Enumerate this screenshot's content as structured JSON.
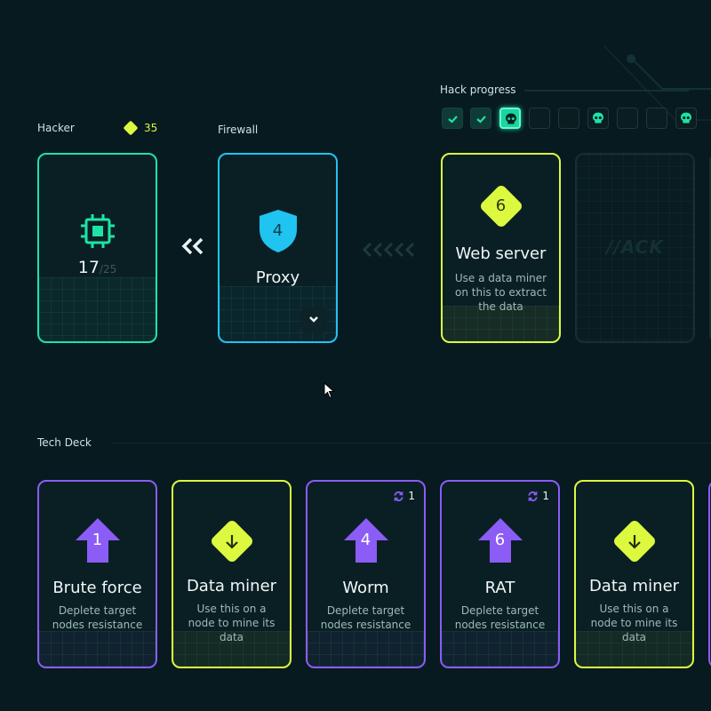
{
  "hacker": {
    "label": "Hacker",
    "currency": "35",
    "hp": "17",
    "hp_max": "/25"
  },
  "firewall": {
    "label": "Firewall",
    "value": "4",
    "name": "Proxy"
  },
  "hack_progress": {
    "label": "Hack progress",
    "steps": [
      "done",
      "done",
      "current-skull",
      "empty",
      "empty",
      "skull",
      "empty",
      "empty",
      "skull"
    ]
  },
  "target": {
    "value": "6",
    "name": "Web server",
    "desc": "Use a data miner on this to extract the data"
  },
  "locked_card_logo": "//ACK",
  "tech_deck": {
    "label": "Tech Deck",
    "cards": [
      {
        "type": "attack",
        "value": "1",
        "name": "Brute force",
        "desc": "Deplete target nodes resistance",
        "badge": ""
      },
      {
        "type": "miner",
        "value": "",
        "name": "Data miner",
        "desc": "Use this on a node to mine its data",
        "badge": ""
      },
      {
        "type": "attack",
        "value": "4",
        "name": "Worm",
        "desc": "Deplete target nodes resistance",
        "badge": "1"
      },
      {
        "type": "attack",
        "value": "6",
        "name": "RAT",
        "desc": "Deplete target nodes resistance",
        "badge": "1"
      },
      {
        "type": "miner",
        "value": "",
        "name": "Data miner",
        "desc": "Use this on a node to mine its data",
        "badge": ""
      }
    ]
  },
  "colors": {
    "bg": "#071a1f",
    "green": "#1ee3a4",
    "cyan": "#20c4f0",
    "yellow": "#dcf93f",
    "purple": "#8b5cf6"
  }
}
